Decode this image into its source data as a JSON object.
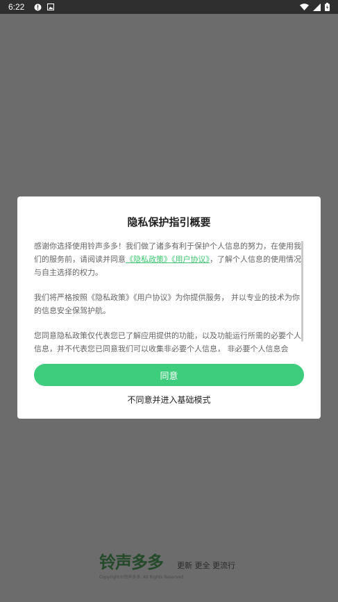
{
  "status_bar": {
    "time": "6:22"
  },
  "dialog": {
    "title": "隐私保护指引概要",
    "paragraph1": {
      "text_before": "感谢你选择使用铃声多多！我们做了诸多有利于保护个人信息的努力，在使用我们的服务前，请阅读并同意",
      "privacy_link": "《隐私政策》",
      "user_link": "《用户协议》",
      "text_after": "，了解个人信息的使用情况与自主选择的权力。"
    },
    "paragraph2": "我们将严格按照《隐私政策》《用户协议》为你提供服务， 并以专业的技术为你的信息安全保驾护航。",
    "paragraph3": " 您同意隐私政策仅代表您已了解应用提供的功能，以及功能运行所需的必要个人信息，并不代表您已同意我们可以收集非必要个人信息， 非必要个人信息会",
    "agree_button": "同意",
    "basic_mode_link": "不同意并进入基础模式"
  },
  "brand": {
    "logo": "铃声多多",
    "slogan": "更新 更全 更流行",
    "copyright": "Copyright©铃声多多. All Rights Reserved"
  },
  "colors": {
    "accent": "#3ecd7c",
    "link": "#3cc870",
    "scrim": "#6c6c6c",
    "statusbar": "#2f2f2f"
  }
}
